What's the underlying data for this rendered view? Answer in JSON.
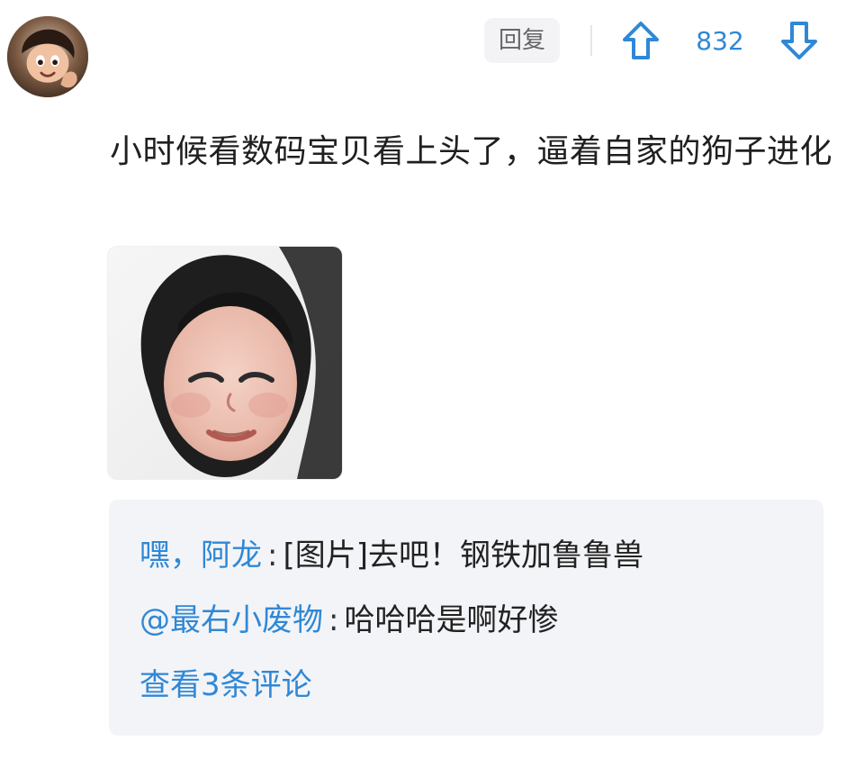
{
  "header": {
    "reply_label": "回复",
    "vote_count": "832",
    "icons": {
      "upvote": "arrow-up-outline",
      "downvote": "arrow-down-outline"
    },
    "accent_color": "#2f88d6"
  },
  "comment": {
    "text": "小时候看数码宝贝看上头了，逼着自家的狗子进化"
  },
  "replies": {
    "items": [
      {
        "user": "嘿，阿龙",
        "content": "[图片]去吧！钢铁加鲁鲁兽"
      },
      {
        "user": "@最右小废物",
        "content": "哈哈哈是啊好惨"
      }
    ],
    "more_label": "查看3条评论"
  }
}
